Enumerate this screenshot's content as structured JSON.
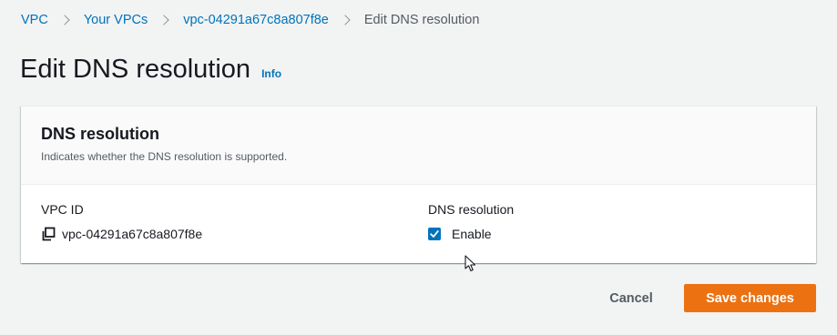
{
  "breadcrumb": {
    "items": [
      "VPC",
      "Your VPCs",
      "vpc-04291a67c8a807f8e"
    ],
    "current": "Edit DNS resolution"
  },
  "page": {
    "title": "Edit DNS resolution",
    "info_link": "Info"
  },
  "panel": {
    "title": "DNS resolution",
    "description": "Indicates whether the DNS resolution is supported.",
    "vpc_id_label": "VPC ID",
    "vpc_id_value": "vpc-04291a67c8a807f8e",
    "dns_label": "DNS resolution",
    "enable_label": "Enable",
    "enable_checked": true
  },
  "actions": {
    "cancel_label": "Cancel",
    "save_label": "Save changes"
  },
  "colors": {
    "link": "#0073bb",
    "primary_button": "#ec7211",
    "background": "#f2f3f3",
    "checkbox": "#0073bb"
  },
  "icons": {
    "copy": "copy-icon",
    "check": "checkmark-icon",
    "breadcrumb_separator": "chevron-right-icon",
    "cursor": "mouse-pointer-icon"
  }
}
